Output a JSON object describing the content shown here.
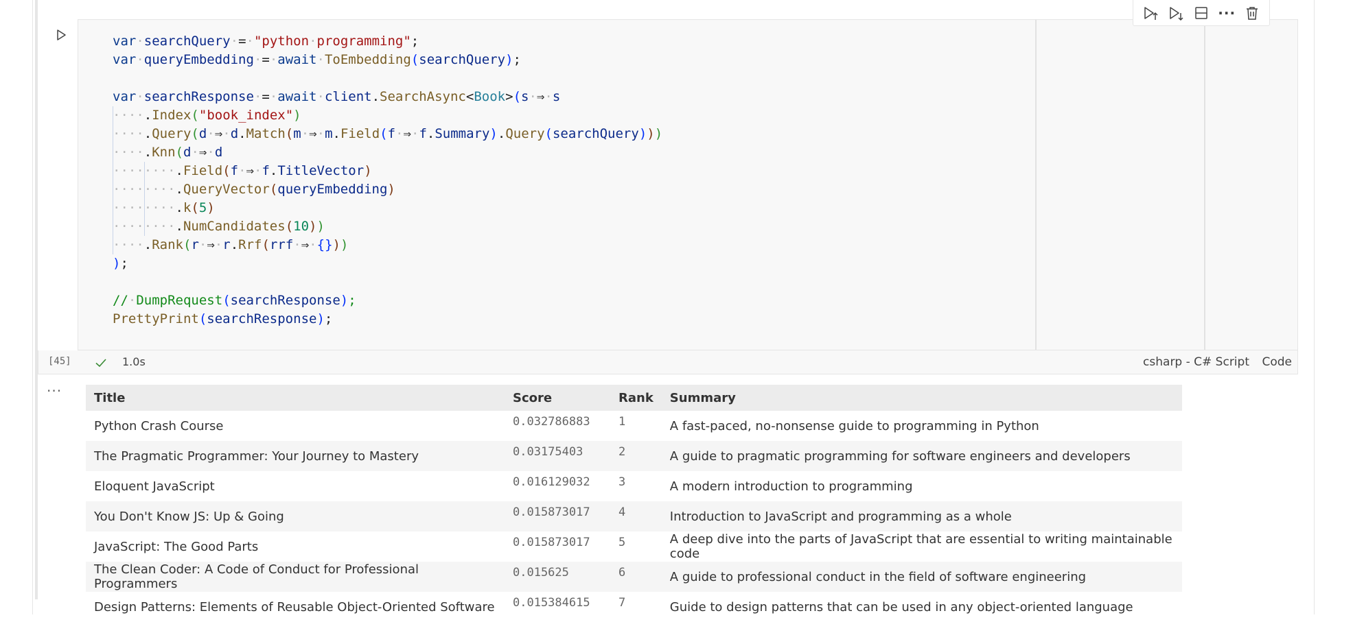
{
  "toolbar": {
    "buttons": [
      {
        "name": "run-above",
        "icon": "run-above-icon"
      },
      {
        "name": "run-below",
        "icon": "run-below-icon"
      },
      {
        "name": "split-cell",
        "icon": "split-cell-icon"
      },
      {
        "name": "more-actions",
        "icon": "more-icon",
        "label": "···"
      },
      {
        "name": "delete-cell",
        "icon": "trash-icon"
      }
    ]
  },
  "cell": {
    "run_icon": "play-icon",
    "code_lines": [
      "var searchQuery = \"python programming\";",
      "var queryEmbedding = await ToEmbedding(searchQuery);",
      "",
      "var searchResponse = await client.SearchAsync<Book>(s => s",
      "    .Index(\"book_index\")",
      "    .Query(d => d.Match(m => m.Field(f => f.Summary).Query(searchQuery)))",
      "    .Knn(d => d",
      "        .Field(f => f.TitleVector)",
      "        .QueryVector(queryEmbedding)",
      "        .k(5)",
      "        .NumCandidates(10))",
      "    .Rank(r => r.Rrf(rrf => {}))",
      ");",
      "",
      "// DumpRequest(searchResponse);",
      "PrettyPrint(searchResponse);"
    ],
    "execution_count": "[45]",
    "status_icon": "check-icon",
    "duration": "1.0s",
    "language": "csharp - C# Script",
    "cell_kind": "Code"
  },
  "output": {
    "more_label": "···",
    "columns": [
      "Title",
      "Score",
      "Rank",
      "Summary"
    ],
    "rows": [
      {
        "title": "Python Crash Course",
        "score": "0.032786883",
        "rank": "1",
        "summary": "A fast-paced, no-nonsense guide to programming in Python"
      },
      {
        "title": "The Pragmatic Programmer: Your Journey to Mastery",
        "score": "0.03175403",
        "rank": "2",
        "summary": "A guide to pragmatic programming for software engineers and developers"
      },
      {
        "title": "Eloquent JavaScript",
        "score": "0.016129032",
        "rank": "3",
        "summary": "A modern introduction to programming"
      },
      {
        "title": "You Don't Know JS: Up & Going",
        "score": "0.015873017",
        "rank": "4",
        "summary": "Introduction to JavaScript and programming as a whole"
      },
      {
        "title": "JavaScript: The Good Parts",
        "score": "0.015873017",
        "rank": "5",
        "summary": "A deep dive into the parts of JavaScript that are essential to writing maintainable code"
      },
      {
        "title": "The Clean Coder: A Code of Conduct for Professional Programmers",
        "score": "0.015625",
        "rank": "6",
        "summary": "A guide to professional conduct in the field of software engineering"
      },
      {
        "title": "Design Patterns: Elements of Reusable Object-Oriented Software",
        "score": "0.015384615",
        "rank": "7",
        "summary": "Guide to design patterns that can be used in any object-oriented language"
      }
    ]
  }
}
